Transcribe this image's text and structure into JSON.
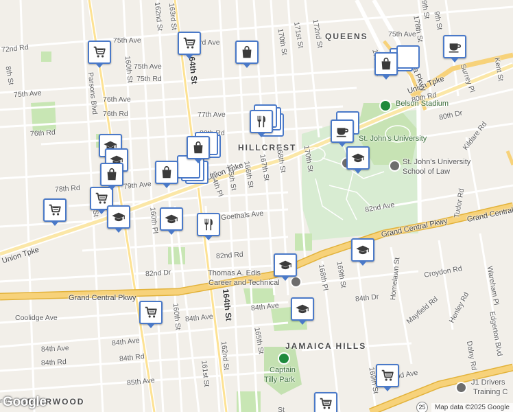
{
  "map": {
    "area_labels": {
      "queens": "QUEENS",
      "hillcrest": "HILLCREST",
      "jamaica_hills": "JAMAICA HILLS",
      "briarwood": "BRIARWOOD"
    },
    "streets": {
      "s72nd_rd": "72nd Rd",
      "s75th_ave_a": "75th Ave",
      "s75th_ave_b": "75th Ave",
      "s75th_ave_c": "75th Ave",
      "s75th_rd": "75th Rd",
      "s76th_ave": "76th Ave",
      "s76th_rd_a": "76th Rd",
      "s76th_rd_b": "76th Rd",
      "s77th_ave": "77th Ave",
      "s78th_rd": "78th Rd",
      "s79th_ave": "79th Ave",
      "s80th_rd": "80th Rd",
      "s80th_dr": "80th Dr",
      "s82nd_ave": "82nd Ave",
      "s82nd_rd": "82nd Rd",
      "s82nd_dr": "82nd Dr",
      "s84th_ave_a": "84th Ave",
      "s84th_ave_b": "84th Ave",
      "s84th_ave_c": "84th Ave",
      "s84th_ave_d": "84th Ave",
      "s84th_rd_a": "84th Rd",
      "s84th_rd_b": "84th Rd",
      "s85th_ave": "85th Ave",
      "s84th_dr": "84th Dr",
      "coolidge": "Coolidge Ave",
      "goethals": "Goethals Ave",
      "croydon": "Croydon Rd",
      "mayfield": "Mayfield Rd",
      "henley": "Henley Rd",
      "kildare": "Kildare Rd",
      "tudor": "Tudor Rd",
      "surrey": "Surrey Pl",
      "kent": "Kent St",
      "wareham": "Wareham Pl",
      "dalny": "Dalny Rd",
      "homelawn": "Homelawn St",
      "edgerton": "Edgerton Blvd",
      "parsons": "Parsons Blvd",
      "s153rd": "153rd St",
      "s160th_a": "160th St",
      "s160th_b": "160th St",
      "s160th_pl": "160th Pl",
      "s161st": "161st St",
      "s162nd_a": "162nd St",
      "s162nd_b": "162nd St",
      "s163rd": "163rd St",
      "s164th_a": "164th St",
      "s164th_b": "164th St",
      "s164th_pl": "164th Pl",
      "s165th_a": "165th St",
      "s165th_b": "165th St",
      "s166th": "166th St",
      "s167th": "167th St",
      "s168th_a": "168th St",
      "s168th_pl": "168th Pl",
      "s169th_a": "169th St",
      "s169th_b": "169th St",
      "s170th_a": "170th St",
      "s170th_b": "170th St",
      "s171st": "171st St",
      "s172nd": "172nd St",
      "s176th": "176th St",
      "s178th": "178th St",
      "s79th_st": "79th St",
      "s80th_rd_b": "80th Rd",
      "s8th_st": "8th St",
      "s9th_st": "9th St",
      "hi_st": "St",
      "s75th_ave_e": "75th Ave",
      "union_tpke_w": "Union Tpke",
      "union_tpke_mid": "Union Tpke",
      "union_tpke_e": "Union Tpke",
      "gcp_w": "Grand Central Pkwy",
      "gcp_mid": "Grand Central Pkwy",
      "gcp_e": "Grand Central Pkwy",
      "utopia_pkwy": "Utopia Pkwy",
      "highland_ave": "Highland Ave",
      "third_ave": "rd Ave",
      "crescent": "rescent"
    },
    "pois": {
      "belson": "Belson Stadium",
      "stjohns": "St. John's University",
      "stjohns_law": "St. John's University School of Law",
      "stjohns_law_1": "St. John's University",
      "stjohns_law_2": "School of Law",
      "edison": "Thomas A. Edison Career and Technical...",
      "edison_1": "Thomas A. Edis",
      "edison_2": "Career and Technical",
      "tilly": "Captain Tilly Park",
      "tilly_1": "Captain",
      "tilly_2": "Tilly Park",
      "j1": "J1 Drivers Training Center",
      "j1_1": "J1 Drivers",
      "j1_2": "Training C"
    },
    "markers": [
      {
        "type": "shopping-cart",
        "tag": "supermarket"
      },
      {
        "type": "shopping-cart",
        "tag": "supermarket"
      },
      {
        "type": "shopping-bag",
        "tag": "store"
      },
      {
        "type": "shopping-cart",
        "tag": "supermarket"
      },
      {
        "type": "shopping-bag",
        "tag": "store"
      },
      {
        "type": "coffee-cup",
        "tag": "cafe"
      },
      {
        "type": "utensils",
        "tag": "restaurant"
      },
      {
        "type": "graduation-cap",
        "tag": "school"
      },
      {
        "type": "shopping-bag",
        "tag": "store"
      },
      {
        "type": "coffee-cup",
        "tag": "cafe"
      },
      {
        "type": "graduation-cap",
        "tag": "school"
      },
      {
        "type": "graduation-cap",
        "tag": "school"
      },
      {
        "type": "shopping-bag",
        "tag": "store"
      },
      {
        "type": "shopping-bag",
        "tag": "store"
      },
      {
        "type": "shopping-cart",
        "tag": "supermarket"
      },
      {
        "type": "graduation-cap",
        "tag": "school"
      },
      {
        "type": "graduation-cap",
        "tag": "school"
      },
      {
        "type": "utensils",
        "tag": "restaurant"
      },
      {
        "type": "graduation-cap",
        "tag": "school"
      },
      {
        "type": "graduation-cap",
        "tag": "school"
      },
      {
        "type": "shopping-cart",
        "tag": "supermarket"
      },
      {
        "type": "graduation-cap",
        "tag": "school"
      },
      {
        "type": "shopping-cart",
        "tag": "supermarket"
      },
      {
        "type": "shopping-cart",
        "tag": "supermarket"
      }
    ],
    "highway_shields": {
      "s25": "25"
    },
    "colors": {
      "land": "#f2efe9",
      "park": "#c8e6b4",
      "campus": "#d4ecd0",
      "highway": "#f7d27a",
      "highway_edge": "#e2b23a",
      "road": "#ffffff",
      "marker_border": "#4a79c8",
      "water": "#aad3df"
    },
    "logo": "Google",
    "attribution": "Map data ©2025 Google"
  }
}
